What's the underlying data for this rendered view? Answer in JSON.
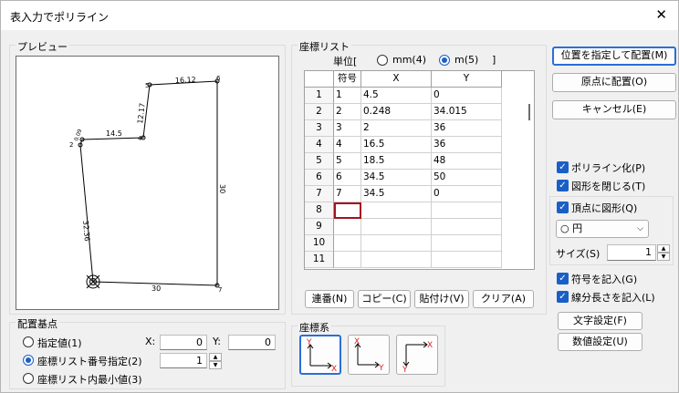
{
  "window": {
    "title": "表入力でポリライン",
    "close": "✕"
  },
  "preview": {
    "label": "プレビュー",
    "seg_labels": [
      "16.12",
      "12.17",
      "14.5",
      "0.09",
      "32.36",
      "30",
      "30"
    ],
    "pt_labels": [
      "1",
      "2",
      "3",
      "4",
      "5",
      "6",
      "7"
    ]
  },
  "coordlist": {
    "label": "座標リスト",
    "unit_prefix": "単位[",
    "unit_mm": "mm(4)",
    "unit_m": "m(5)",
    "unit_suffix": "]",
    "selected_unit": "m",
    "col_headers": [
      "符号",
      "X",
      "Y"
    ],
    "rows": [
      {
        "n": "1",
        "sym": "1",
        "x": "4.5",
        "y": "0"
      },
      {
        "n": "2",
        "sym": "2",
        "x": "0.248",
        "y": "34.015"
      },
      {
        "n": "3",
        "sym": "3",
        "x": "2",
        "y": "36"
      },
      {
        "n": "4",
        "sym": "4",
        "x": "16.5",
        "y": "36"
      },
      {
        "n": "5",
        "sym": "5",
        "x": "18.5",
        "y": "48"
      },
      {
        "n": "6",
        "sym": "6",
        "x": "34.5",
        "y": "50"
      },
      {
        "n": "7",
        "sym": "7",
        "x": "34.5",
        "y": "0"
      },
      {
        "n": "8",
        "sym": "",
        "x": "",
        "y": ""
      },
      {
        "n": "9",
        "sym": "",
        "x": "",
        "y": ""
      },
      {
        "n": "10",
        "sym": "",
        "x": "",
        "y": ""
      },
      {
        "n": "11",
        "sym": "",
        "x": "",
        "y": ""
      }
    ],
    "buttons": [
      "連番(N)",
      "コピー(C)",
      "貼付け(V)",
      "クリア(A)"
    ]
  },
  "right_buttons": [
    "位置を指定して配置(M)",
    "原点に配置(O)",
    "キャンセル(E)"
  ],
  "options": {
    "polyline": "ポリライン化(P)",
    "close_shape": "図形を閉じる(T)",
    "vertex_shape": "頂点に図形(Q)",
    "shape_select": "○ 円",
    "size_label": "サイズ(S)",
    "size_value": "1",
    "write_symbol": "符号を記入(G)",
    "write_length": "線分長さを記入(L)",
    "text_setting": "文字設定(F)",
    "number_setting": "数値設定(U)"
  },
  "base_point": {
    "label": "配置基点",
    "opt1": "指定値(1)",
    "opt2": "座標リスト番号指定(2)",
    "opt3": "座標リスト内最小値(3)",
    "x_label": "X:",
    "x_value": "0",
    "y_label": "Y:",
    "y_value": "0",
    "list_no": "1"
  },
  "coord_system": {
    "label": "座標系"
  },
  "colors": {
    "accent": "#1a5fc7",
    "axis_red": "#e02020"
  }
}
